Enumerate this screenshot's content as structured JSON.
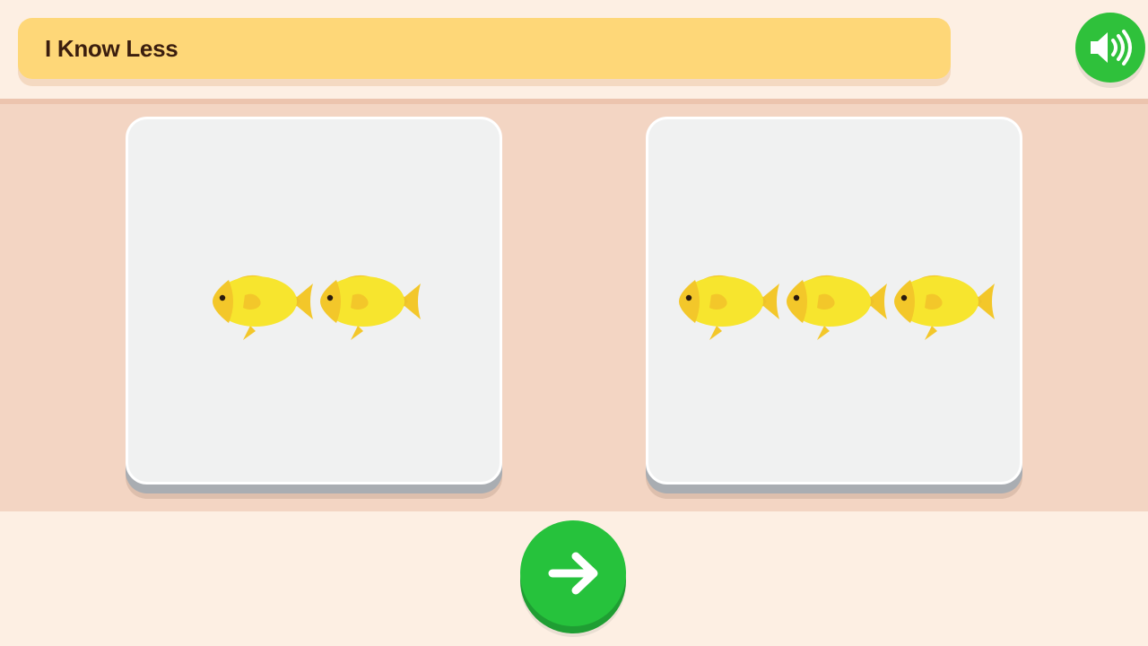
{
  "header": {
    "title": "I Know Less",
    "audio_icon": "speaker-icon"
  },
  "cards": [
    {
      "id": "left",
      "fish_count": 2,
      "item_icon": "fish-icon"
    },
    {
      "id": "right",
      "fish_count": 3,
      "item_icon": "fish-icon"
    }
  ],
  "footer": {
    "next_icon": "arrow-right-icon"
  },
  "colors": {
    "background": "#fdefe3",
    "play_area": "#f3d5c3",
    "title_banner": "#fed778",
    "button_green": "#26c23c",
    "fish_yellow": "#f7e52e",
    "card": "#f0f1f1"
  }
}
